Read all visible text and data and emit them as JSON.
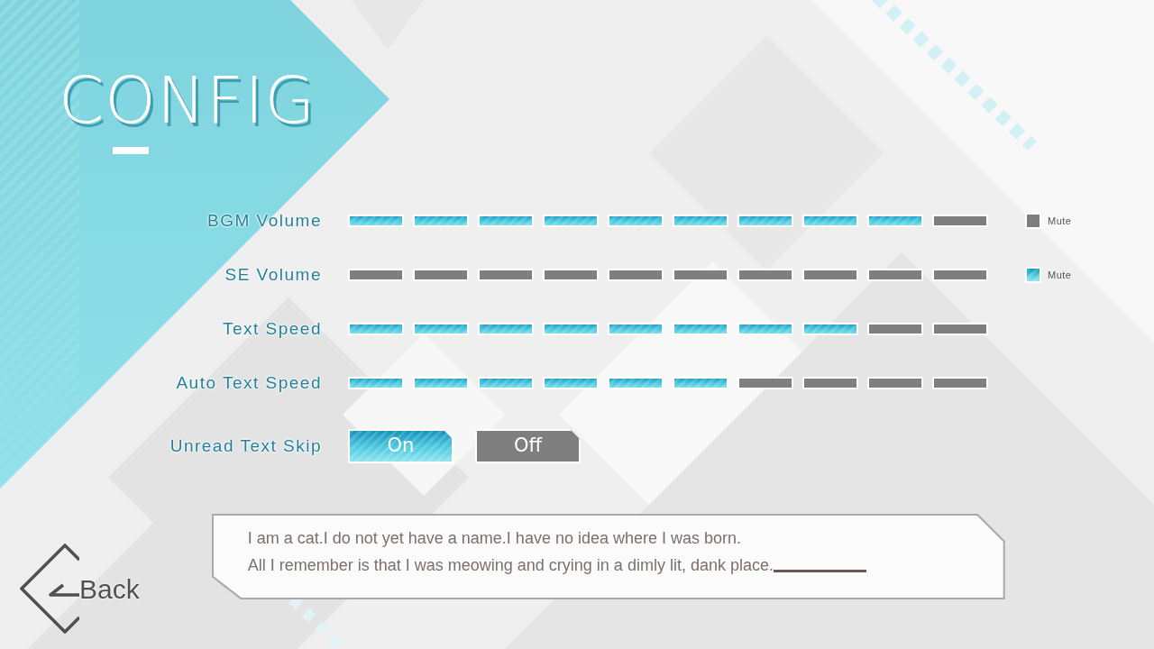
{
  "title": "CONFIG",
  "settings": [
    {
      "kind": "slider",
      "label": "BGM Volume",
      "level": 0.9,
      "mute": {
        "label": "Mute",
        "checked": false
      }
    },
    {
      "kind": "slider",
      "label": "SE Volume",
      "level": 0,
      "mute": {
        "label": "Mute",
        "checked": true
      }
    },
    {
      "kind": "slider",
      "label": "Text Speed",
      "level": 0.8
    },
    {
      "kind": "slider",
      "label": "Auto Text Speed",
      "level": 0.6
    },
    {
      "kind": "toggle",
      "label": "Unread Text Skip",
      "options": [
        {
          "label": "On",
          "selected": true
        },
        {
          "label": "Off",
          "selected": false
        }
      ]
    }
  ],
  "message_preview": {
    "lines": [
      "I am a cat.I do not yet have a name.I have no idea where I was born.",
      "All I remember is that I was meowing and crying in a dimly lit, dank place."
    ]
  },
  "back_button": {
    "label": "Back"
  }
}
